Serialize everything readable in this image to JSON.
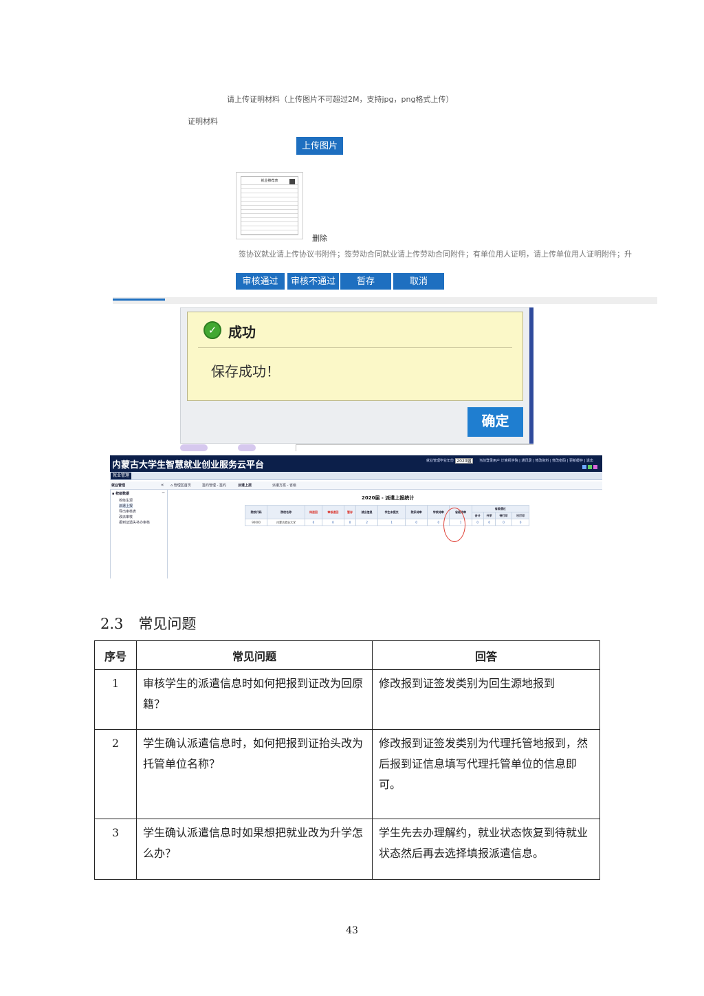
{
  "upload_form": {
    "hint": "请上传证明材料（上传图片不可超过2M，支持jpg，png格式上传）",
    "proof_label": "证明材料",
    "upload_button": "上传图片",
    "thumbnail_title": "就业推荐表",
    "delete_link": "删除",
    "attachment_note": "签协议就业请上传协议书附件；签劳动合同就业请上传劳动合同附件；有单位用人证明，请上传单位用人证明附件；升",
    "buttons": [
      "审核通过",
      "审核不通过",
      "暂存",
      "取消"
    ],
    "accent_color": "#1e6fc0"
  },
  "success_dialog": {
    "title": "成功",
    "message": "保存成功！",
    "confirm_button": "确定",
    "icon": "check-circle-icon"
  },
  "platform": {
    "title": "内蒙古大学生智慧就业创业服务云平台",
    "year_label": "就业管理毕业年份",
    "year_value": "2020届",
    "header_links": "当前登录用户 计算机学院 | 通讯录 | 修改资料 | 修改密码 | 更新缓存 | 退出",
    "main_tab": "就业管理",
    "sidebar_header": "就业管理",
    "collapse_icon": "double-chevron-left-icon",
    "tabs": [
      "管理区首页",
      "签约管理 - 签约",
      "派遣上报",
      "派遣方案 - 省级"
    ],
    "sidebar_root": "校级数据",
    "sidebar_items": [
      "校级生源",
      "派遣上报",
      "导出审核表",
      "改派审核",
      "报到证遗失补办审核"
    ],
    "stats_title": "2020届 - 派遣上报统计",
    "table_headers": [
      "院校代码",
      "院校名称",
      "待退回",
      "审核退回",
      "暂存",
      "就业信息",
      "学生未提交",
      "院系待审",
      "学校待审",
      "省级待审"
    ],
    "provincial_passed": "省级通过",
    "provincial_sub_headers": [
      "合计",
      "升学",
      "待打印",
      "已打印"
    ],
    "row": [
      "90000",
      "内蒙古就业大学",
      "0",
      "0",
      "0",
      "2",
      "1",
      "0",
      "0",
      "1",
      "0",
      "0",
      "0",
      "0"
    ]
  },
  "section": {
    "number": "2.3",
    "title": "常见问题"
  },
  "faq": {
    "headers": [
      "序号",
      "常见问题",
      "回答"
    ],
    "rows": [
      {
        "no": "1",
        "question": "审核学生的派遣信息时如何把报到证改为回原籍？",
        "answer": "修改报到证签发类别为回生源地报到"
      },
      {
        "no": "2",
        "question": "学生确认派遣信息时，如何把报到证抬头改为托管单位名称？",
        "answer": "修改报到证签发类别为代理托管地报到，然后报到证信息填写代理托管单位的信息即可。"
      },
      {
        "no": "3",
        "question": "学生确认派遣信息时如果想把就业改为升学怎么办？",
        "answer": "学生先去办理解约，就业状态恢复到待就业状态然后再去选择填报派遣信息。"
      }
    ]
  },
  "page_number": "43"
}
